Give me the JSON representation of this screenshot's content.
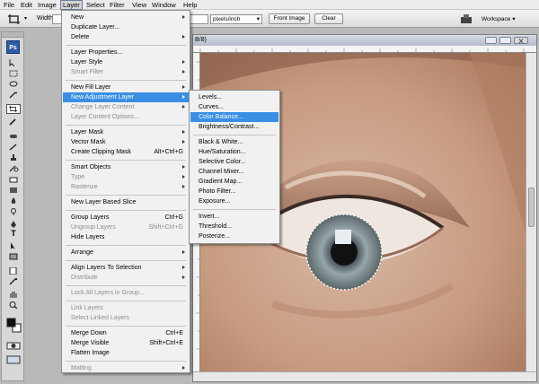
{
  "menubar": {
    "items": [
      {
        "label": "File"
      },
      {
        "label": "Edit"
      },
      {
        "label": "Image"
      },
      {
        "label": "Layer"
      },
      {
        "label": "Select"
      },
      {
        "label": "Filter"
      },
      {
        "label": "View"
      },
      {
        "label": "Window"
      },
      {
        "label": "Help"
      }
    ],
    "active": "Layer"
  },
  "options_bar": {
    "width_label": "Width:",
    "resolution_unit": "pixels/inch",
    "front_image_label": "Front Image",
    "clear_label": "Clear",
    "workspace_label": "Workspace ▾"
  },
  "tools_panel": {
    "logo": "Ps"
  },
  "document": {
    "title_fragment": "B/8)"
  },
  "layer_menu": {
    "items": [
      {
        "label": "New",
        "submenu": true,
        "enabled": true
      },
      {
        "label": "Duplicate Layer...",
        "enabled": true
      },
      {
        "label": "Delete",
        "submenu": true,
        "enabled": true
      },
      {
        "label": "Layer Properties...",
        "enabled": true
      },
      {
        "label": "Layer Style",
        "submenu": true,
        "enabled": true
      },
      {
        "label": "Smart Filter",
        "submenu": true,
        "enabled": false
      },
      {
        "label": "New Fill Layer",
        "submenu": true,
        "enabled": true
      },
      {
        "label": "New Adjustment Layer",
        "submenu": true,
        "enabled": true,
        "highlighted": true
      },
      {
        "label": "Change Layer Content",
        "submenu": true,
        "enabled": false
      },
      {
        "label": "Layer Content Options...",
        "enabled": false
      },
      {
        "label": "Layer Mask",
        "submenu": true,
        "enabled": true
      },
      {
        "label": "Vector Mask",
        "submenu": true,
        "enabled": true
      },
      {
        "label": "Create Clipping Mask",
        "shortcut": "Alt+Ctrl+G",
        "enabled": true
      },
      {
        "label": "Smart Objects",
        "submenu": true,
        "enabled": true
      },
      {
        "label": "Type",
        "submenu": true,
        "enabled": false
      },
      {
        "label": "Rasterize",
        "submenu": true,
        "enabled": false
      },
      {
        "label": "New Layer Based Slice",
        "enabled": true
      },
      {
        "label": "Group Layers",
        "shortcut": "Ctrl+G",
        "enabled": true
      },
      {
        "label": "Ungroup Layers",
        "shortcut": "Shift+Ctrl+G",
        "enabled": false
      },
      {
        "label": "Hide Layers",
        "enabled": true
      },
      {
        "label": "Arrange",
        "submenu": true,
        "enabled": true
      },
      {
        "label": "Align Layers To Selection",
        "submenu": true,
        "enabled": true
      },
      {
        "label": "Distribute",
        "submenu": true,
        "enabled": false
      },
      {
        "label": "Lock All Layers in Group...",
        "enabled": false
      },
      {
        "label": "Link Layers",
        "enabled": false
      },
      {
        "label": "Select Linked Layers",
        "enabled": false
      },
      {
        "label": "Merge Down",
        "shortcut": "Ctrl+E",
        "enabled": true
      },
      {
        "label": "Merge Visible",
        "shortcut": "Shift+Ctrl+E",
        "enabled": true
      },
      {
        "label": "Flatten Image",
        "enabled": true
      },
      {
        "label": "Matting",
        "submenu": true,
        "enabled": false
      }
    ]
  },
  "adjustment_submenu": {
    "items": [
      {
        "label": "Levels..."
      },
      {
        "label": "Curves..."
      },
      {
        "label": "Color Balance...",
        "highlighted": true
      },
      {
        "label": "Brightness/Contrast..."
      },
      {
        "label": "Black & White..."
      },
      {
        "label": "Hue/Saturation..."
      },
      {
        "label": "Selective Color..."
      },
      {
        "label": "Channel Mixer..."
      },
      {
        "label": "Gradient Map..."
      },
      {
        "label": "Photo Filter..."
      },
      {
        "label": "Exposure..."
      },
      {
        "label": "Invert..."
      },
      {
        "label": "Threshold..."
      },
      {
        "label": "Posterize..."
      }
    ]
  },
  "colors": {
    "menu_highlight": "#3a8fe5",
    "logo_blue": "#2b5da8",
    "skin": "#c49a82",
    "iris": "#8c9aa0"
  }
}
